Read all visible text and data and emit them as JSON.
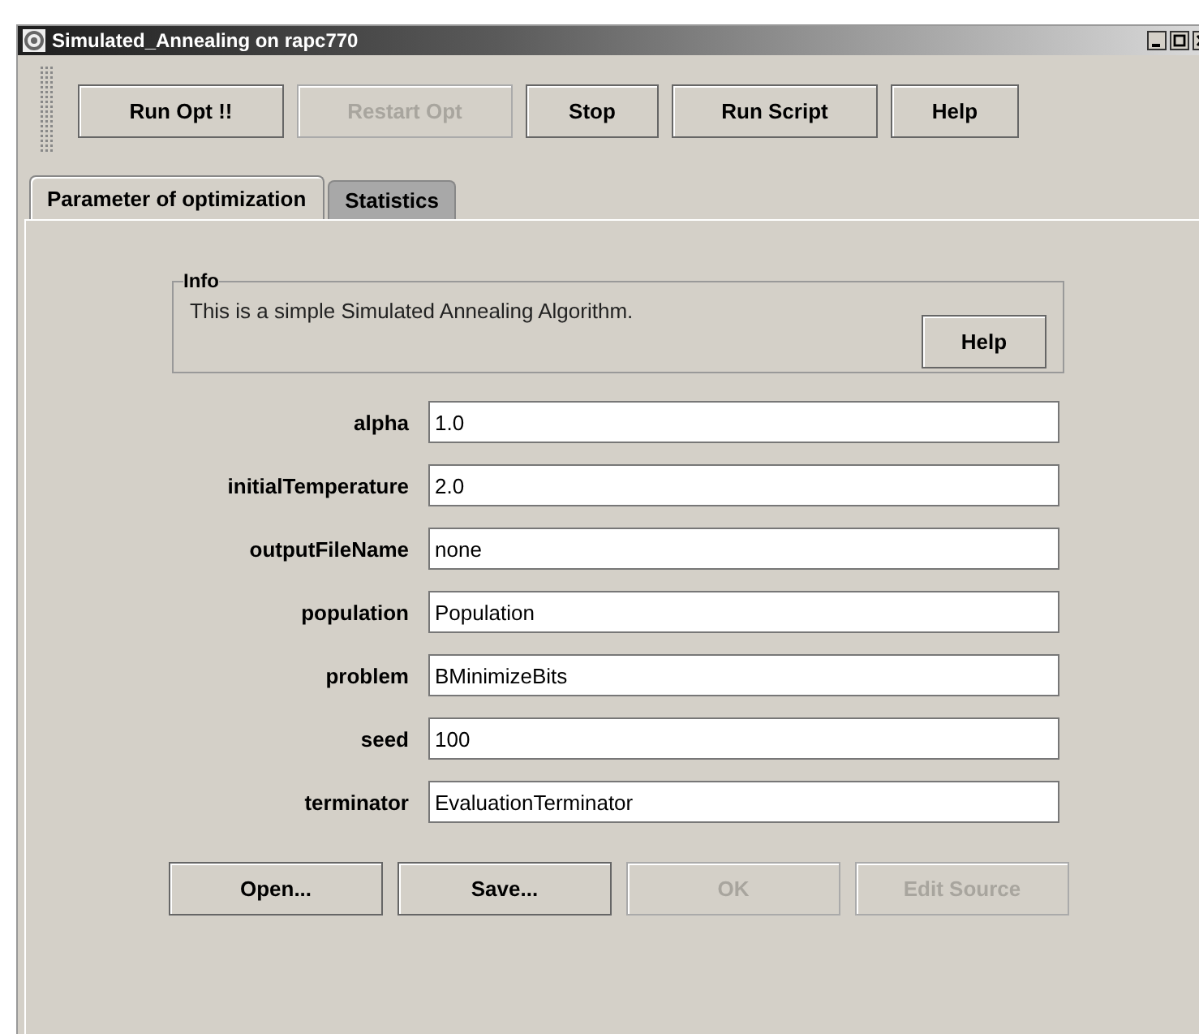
{
  "window": {
    "title": "Simulated_Annealing on rapc770"
  },
  "toolbar": [
    {
      "label": "Run Opt !!",
      "disabled": false
    },
    {
      "label": "Restart Opt",
      "disabled": true
    },
    {
      "label": "Stop",
      "disabled": false
    },
    {
      "label": "Run Script",
      "disabled": false
    },
    {
      "label": "Help",
      "disabled": false
    }
  ],
  "tabs": [
    {
      "label": "Parameter of optimization",
      "selected": true
    },
    {
      "label": "Statistics",
      "selected": false
    }
  ],
  "info": {
    "title": "Info",
    "text": "This is a simple Simulated Annealing Algorithm.",
    "button": "Help"
  },
  "parameters": [
    {
      "label": "alpha",
      "value": "1.0"
    },
    {
      "label": "initialTemperature",
      "value": "2.0"
    },
    {
      "label": "outputFileName",
      "value": "none"
    },
    {
      "label": "population",
      "value": "Population"
    },
    {
      "label": "problem",
      "value": "BMinimizeBits"
    },
    {
      "label": "seed",
      "value": "100"
    },
    {
      "label": "terminator",
      "value": "EvaluationTerminator"
    }
  ],
  "buttons": [
    {
      "label": "Open...",
      "disabled": false
    },
    {
      "label": "Save...",
      "disabled": false
    },
    {
      "label": "OK",
      "disabled": true
    },
    {
      "label": "Edit Source",
      "disabled": true
    }
  ]
}
